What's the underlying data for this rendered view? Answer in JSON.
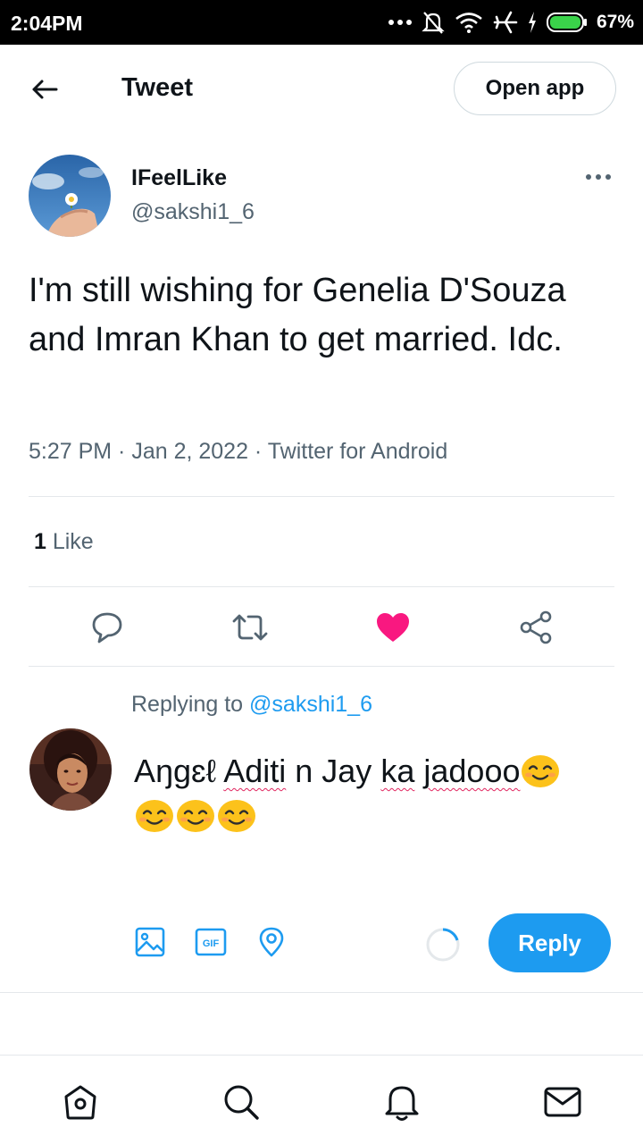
{
  "status_bar": {
    "time": "2:04PM",
    "battery_percent": "67%",
    "icons": [
      "more-dots-icon",
      "mute-bell-icon",
      "wifi-icon",
      "airplane-icon",
      "charging-icon",
      "battery-icon"
    ]
  },
  "header": {
    "title": "Tweet",
    "open_app_label": "Open app",
    "back_icon": "arrow-left-icon"
  },
  "tweet": {
    "author_name": "IFeelLike",
    "author_handle": "@sakshi1_6",
    "text": "I'm still wishing for Genelia D'Souza and Imran Khan to get married. Idc.",
    "meta": "5:27 PM · Jan 2, 2022 · Twitter for Android",
    "like_count": "1",
    "like_label": " Like",
    "liked": true,
    "colors": {
      "like": "#f91880",
      "accent": "#1d9bf0",
      "secondary_text": "#536471"
    }
  },
  "actions": [
    "reply-icon",
    "retweet-icon",
    "like-heart-icon",
    "share-icon"
  ],
  "reply_compose": {
    "replying_prefix": "Replying to ",
    "replying_handle": "@sakshi1_6",
    "text_words": [
      "Aŋgɛℓ",
      "Aditi",
      "n Jay",
      "ka",
      "jadooo"
    ],
    "emoji_count": 4,
    "emoji": "smiling-face-emoji",
    "toolbar_icons": [
      "image-icon",
      "gif-icon",
      "location-pin-icon"
    ],
    "reply_label": "Reply"
  },
  "bottom_nav": [
    "home-icon",
    "search-icon",
    "notifications-bell-icon",
    "messages-envelope-icon"
  ]
}
